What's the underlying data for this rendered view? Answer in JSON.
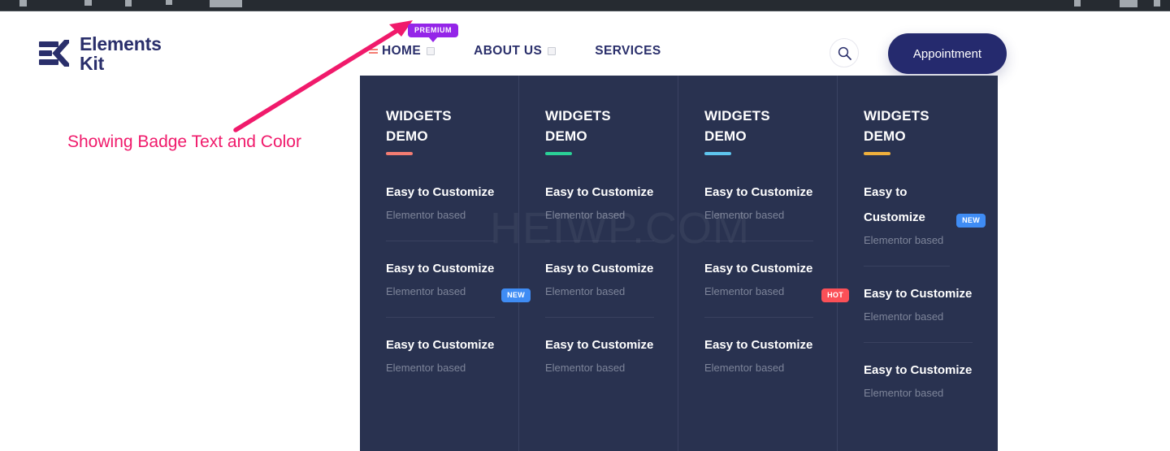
{
  "chrome": {
    "icons": [
      "partial-icon-1",
      "partial-icon-2",
      "partial-icon-3",
      "partial-icon-4",
      "partial-icon-5",
      "partial-icon-6",
      "partial-icon-7",
      "partial-icon-8"
    ]
  },
  "header": {
    "logo": {
      "line1": "Elements",
      "line2": "Kit",
      "mark_name": "elementskit-logo-mark",
      "color": "#2a2f6b"
    },
    "nav": [
      {
        "label": "HOME",
        "has_caret": true,
        "active": true
      },
      {
        "label": "ABOUT US",
        "has_caret": true,
        "active": false
      },
      {
        "label": "SERVICES",
        "has_caret": false,
        "active": false
      }
    ],
    "premium_badge": {
      "label": "PREMIUM",
      "color": "#9425e8",
      "text_color": "#ffffff"
    },
    "search_label": "search-icon",
    "appointment_label": "Appointment",
    "appointment_color": "#252a6e"
  },
  "annotation": {
    "text": "Showing Badge Text and Color",
    "color": "#f01a6b"
  },
  "watermark": {
    "text": "HEIWP.COM"
  },
  "mega_menu": {
    "background": "#293250",
    "columns": [
      {
        "title_line1": "WIDGETS",
        "title_line2": "DEMO",
        "underline_color": "#f47c72",
        "items": [
          {
            "title": "Easy to Customize",
            "sub": "Elementor based",
            "badge": null
          },
          {
            "title": "Easy to Customize",
            "sub": "Elementor based",
            "badge": {
              "label": "NEW",
              "color": "#3f8cf4"
            }
          },
          {
            "title": "Easy to Customize",
            "sub": "Elementor based",
            "badge": null
          }
        ]
      },
      {
        "title_line1": "WIDGETS",
        "title_line2": "DEMO",
        "underline_color": "#2ad197",
        "items": [
          {
            "title": "Easy to Customize",
            "sub": "Elementor based",
            "badge": null
          },
          {
            "title": "Easy to Customize",
            "sub": "Elementor based",
            "badge": null
          },
          {
            "title": "Easy to Customize",
            "sub": "Elementor based",
            "badge": null
          }
        ]
      },
      {
        "title_line1": "WIDGETS",
        "title_line2": "DEMO",
        "underline_color": "#5ec5ee",
        "items": [
          {
            "title": "Easy to Customize",
            "sub": "Elementor based",
            "badge": null
          },
          {
            "title": "Easy to Customize",
            "sub": "Elementor based",
            "badge": {
              "label": "HOT",
              "color": "#fb5057"
            }
          },
          {
            "title": "Easy to Customize",
            "sub": "Elementor based",
            "badge": null
          }
        ]
      },
      {
        "title_line1": "WIDGETS",
        "title_line2": "DEMO",
        "underline_color": "#efb03c",
        "items": [
          {
            "title": "Easy to Customize",
            "sub": "Elementor based",
            "badge": {
              "label": "NEW",
              "color": "#3f8cf4"
            }
          },
          {
            "title": "Easy to Customize",
            "sub": "Elementor based",
            "badge": null
          },
          {
            "title": "Easy to Customize",
            "sub": "Elementor based",
            "badge": null
          }
        ]
      }
    ]
  }
}
